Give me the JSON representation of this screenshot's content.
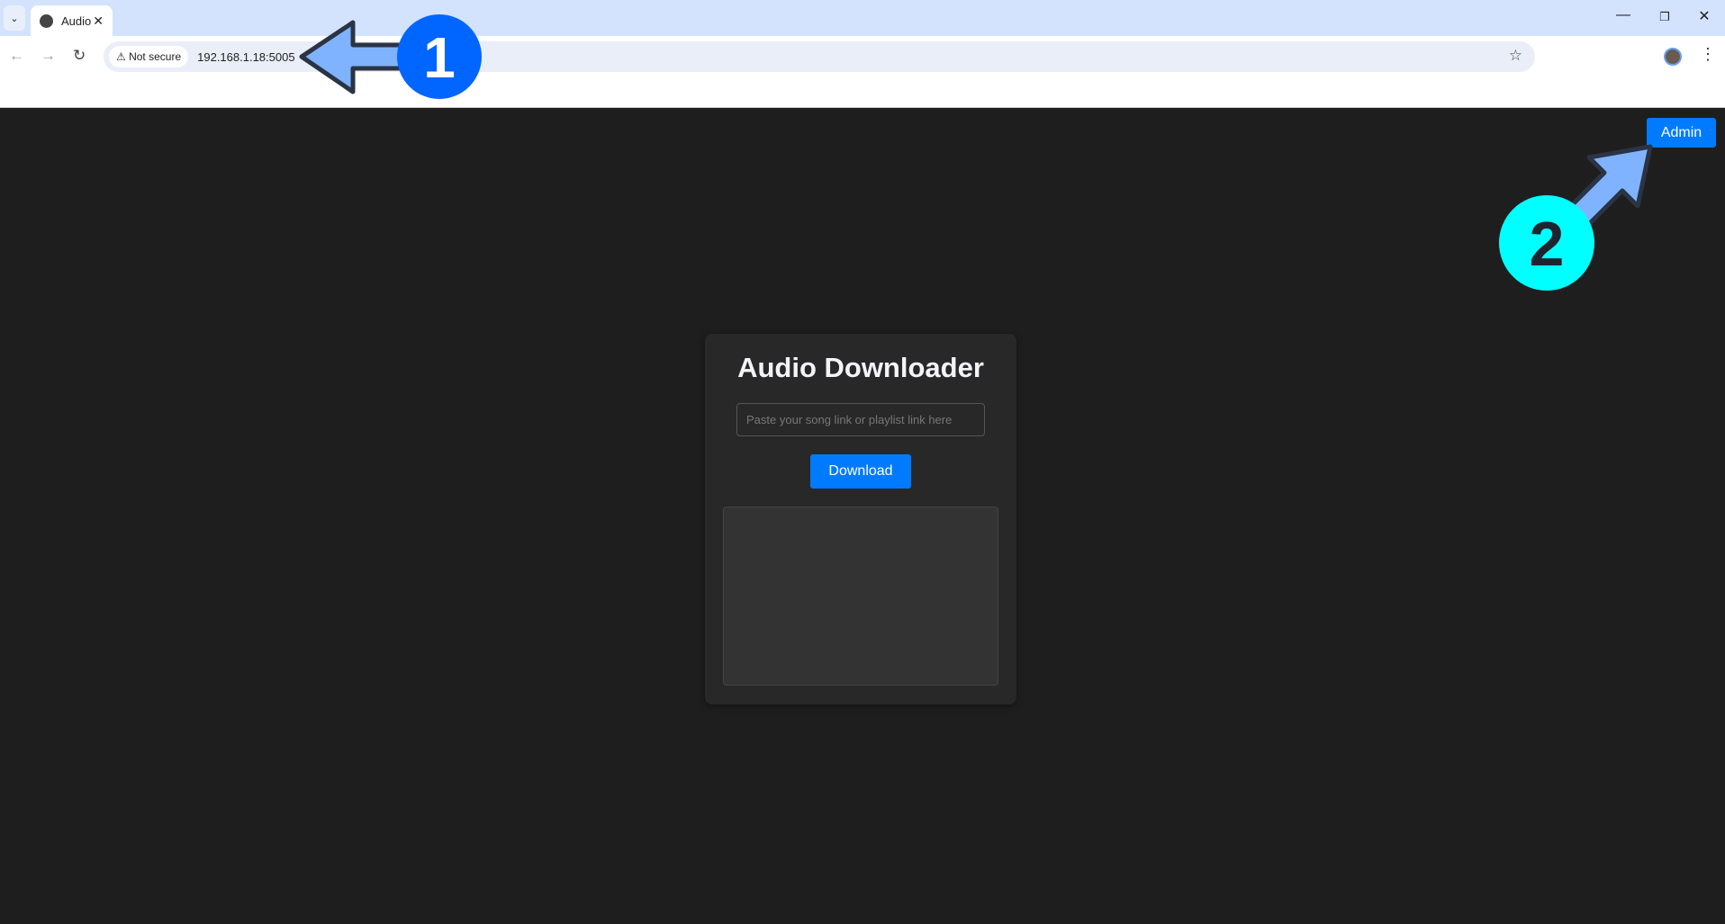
{
  "browser": {
    "tab_title": "Audio",
    "security_label": "Not secure",
    "url": "192.168.1.18:5005"
  },
  "page": {
    "admin_label": "Admin",
    "title": "Audio Downloader",
    "input_placeholder": "Paste your song link or playlist link here",
    "download_label": "Download"
  },
  "annotations": [
    {
      "label": "1",
      "color": "#0066ff"
    },
    {
      "label": "2",
      "color": "#00ffff"
    }
  ],
  "colors": {
    "accent": "#007bff",
    "background": "#1e1e1e",
    "card": "#282828"
  }
}
